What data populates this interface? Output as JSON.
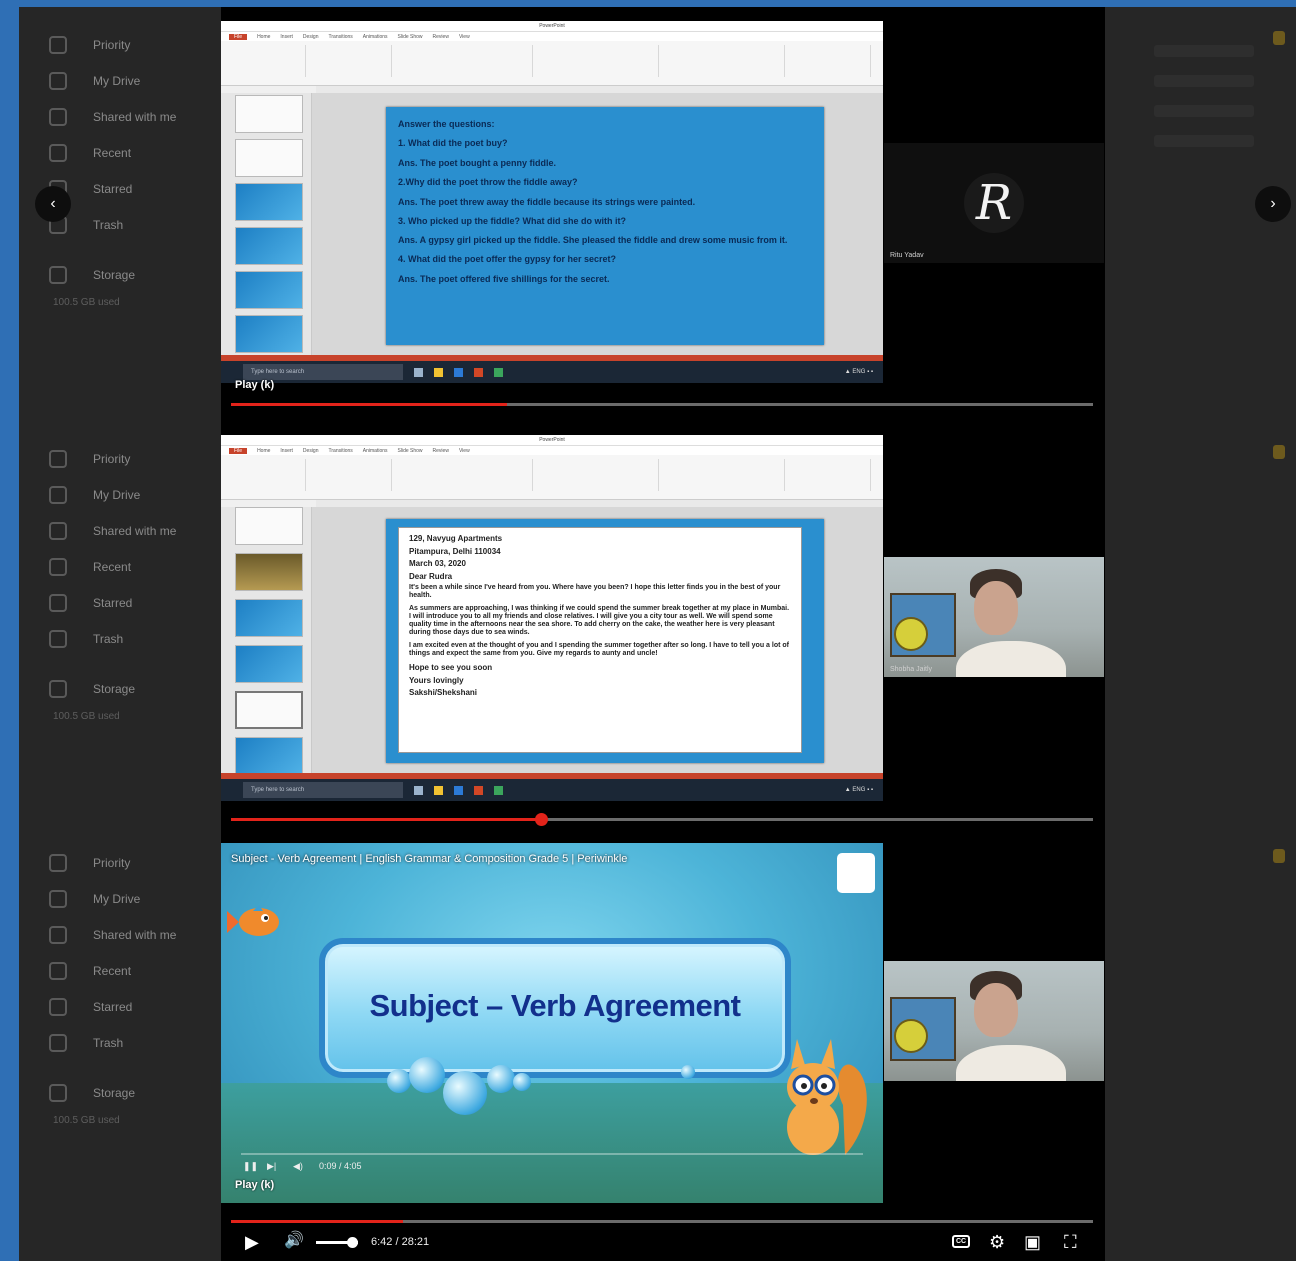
{
  "background_sidebar": {
    "items": [
      "Priority",
      "My Drive",
      "Shared with me",
      "Recent",
      "Starred",
      "Trash"
    ],
    "storage": "Storage",
    "storage_usage": "100.5 GB used"
  },
  "slide1": {
    "heading": "Answer the questions:",
    "lines": [
      "1. What did the poet buy?",
      "Ans. The poet bought a penny fiddle.",
      "2.Why did the poet throw the fiddle away?",
      "Ans. The poet threw away the fiddle because its strings were painted.",
      "3. Who picked up the fiddle? What did she do with it?",
      "Ans. A gypsy girl picked up the fiddle. She pleased the fiddle and drew some music from it.",
      "4. What did the poet offer the gypsy for her secret?",
      "Ans. The poet offered five shillings for the secret."
    ]
  },
  "slide2": {
    "address1": "129, Navyug Apartments",
    "address2": "Pitampura, Delhi 110034",
    "date": "March 03, 2020",
    "greeting": "Dear Rudra",
    "para1": "It's been a while since I've heard from you. Where have you been? I hope this letter finds you in the best of your health.",
    "para2": "As summers are approaching, I was thinking if we could spend the summer break together at my place in Mumbai. I will introduce you to all my friends and close relatives. I will give you a city tour as well. We will spend some quality time in the afternoons near the sea shore. To add cherry on the cake, the weather here is very pleasant during those days due to sea winds.",
    "para3": "I am excited even at the thought of you and I spending the summer together after so long. I have to tell you a lot of things and expect the same from you. Give my regards to aunty and uncle!",
    "closing1": "Hope to see you soon",
    "closing2": "Yours lovingly",
    "closing3": "Sakshi/Shekshani"
  },
  "ppt": {
    "window_title": "PowerPoint",
    "tabs": [
      "File",
      "Home",
      "Insert",
      "Design",
      "Transitions",
      "Animations",
      "Slide Show",
      "Review",
      "View"
    ],
    "taskbar_search": "Type here to search"
  },
  "participants": {
    "initial_letter": "R",
    "initial_name": "Ritu Yadav",
    "cam_name": "Shobha Jaitly"
  },
  "player": {
    "play_tooltip": "Play (k)",
    "video_title": "Subject - Verb Agreement | English Grammar & Composition Grade 5 | Periwinkle",
    "banner": "Subject – Verb Agreement",
    "inner_time": "0:09 / 4:05",
    "time_display": "6:42 / 28:21",
    "progress_top": 0.32,
    "progress_middle": 0.36,
    "progress_bottom": 0.2,
    "volume": 0.85,
    "cc_label": "CC"
  },
  "colors": {
    "outer": "#2f6fb5",
    "progress": "#e2231a",
    "slide_blue": "#2a8fcf",
    "ppt_accent": "#c7432b"
  },
  "icons": {
    "play": "▶",
    "volume": "🔊",
    "settings": "⚙",
    "miniplayer": "▣",
    "fullscreen": "⛶",
    "prev": "‹",
    "next": "›"
  }
}
